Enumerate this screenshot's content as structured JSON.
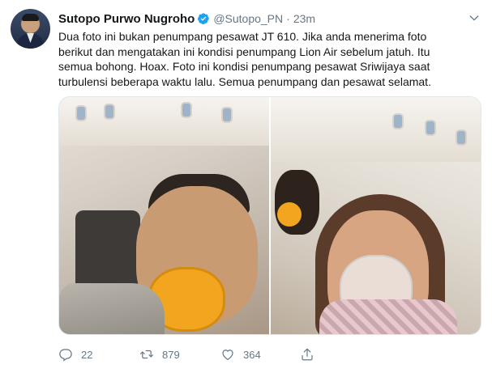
{
  "tweet": {
    "author": {
      "name": "Sutopo Purwo Nugroho",
      "handle": "@Sutopo_PN",
      "separator": "·",
      "time": "23m",
      "verified": true
    },
    "text": "Dua foto ini bukan penumpang pesawat JT 610. Jika anda menerima foto\nberikut dan mengatakan ini kondisi penumpang Lion Air sebelum jatuh. Itu\nsemua bohong. Hoax. Foto ini kondisi penumpang pesawat Sriwijaya saat\nturbulensi beberapa waktu lalu. Semua penumpang dan pesawat selamat.",
    "actions": {
      "reply_count": "22",
      "retweet_count": "879",
      "like_count": "364"
    },
    "icons": {
      "verified": "verified-badge-icon",
      "caret": "chevron-down-icon",
      "reply": "reply-icon",
      "retweet": "retweet-icon",
      "like": "heart-icon",
      "share": "share-icon"
    },
    "colors": {
      "verified": "#1da1f2",
      "secondary_text": "#657786",
      "primary_text": "#14171a"
    }
  }
}
